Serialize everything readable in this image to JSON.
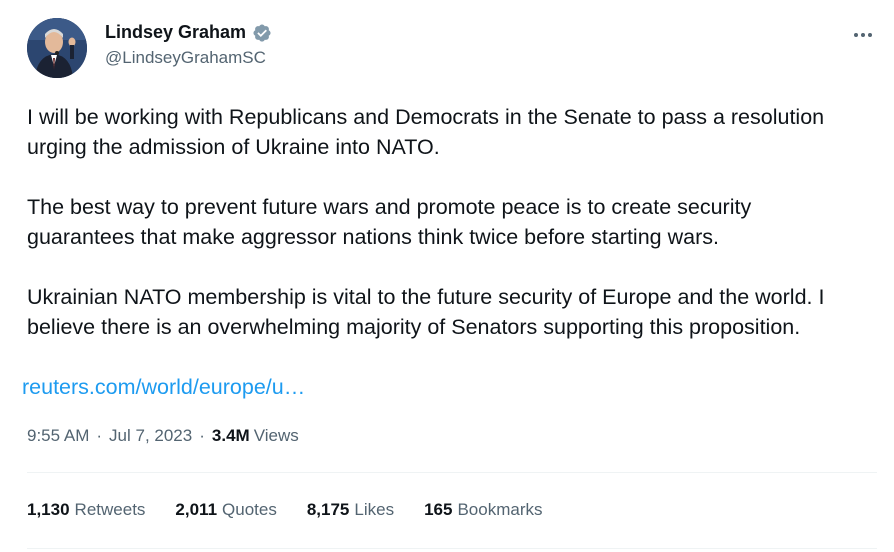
{
  "author": {
    "display_name": "Lindsey Graham",
    "handle": "@LindseyGrahamSC",
    "verified_icon": "verified-badge-icon",
    "avatar_icon": "avatar-photo"
  },
  "tweet": {
    "paragraphs": [
      "I will be working with Republicans and Democrats in the Senate to pass a resolution",
      "urging the admission of Ukraine into NATO.",
      "The best way to prevent future wars and promote peace is to create security",
      "guarantees that make aggressor nations think twice before starting wars.",
      "Ukrainian NATO membership is vital to the future security of Europe and the world. I",
      "believe there is an overwhelming majority of Senators supporting this proposition."
    ],
    "link": "reuters.com/world/europe/u…"
  },
  "meta": {
    "time": "9:55 AM",
    "date_sep": "·",
    "date": "Jul 7, 2023",
    "sep": "·",
    "views_count": "3.4M",
    "views_label": "Views"
  },
  "stats": {
    "retweets": {
      "count": "1,130",
      "label": "Retweets"
    },
    "quotes": {
      "count": "2,011",
      "label": "Quotes"
    },
    "likes": {
      "count": "8,175",
      "label": "Likes"
    },
    "bookmarks": {
      "count": "165",
      "label": "Bookmarks"
    }
  },
  "colors": {
    "link": "#1d9bf0",
    "verified": "#829aab",
    "secondary_text": "#536471",
    "primary_text": "#0f1419"
  }
}
